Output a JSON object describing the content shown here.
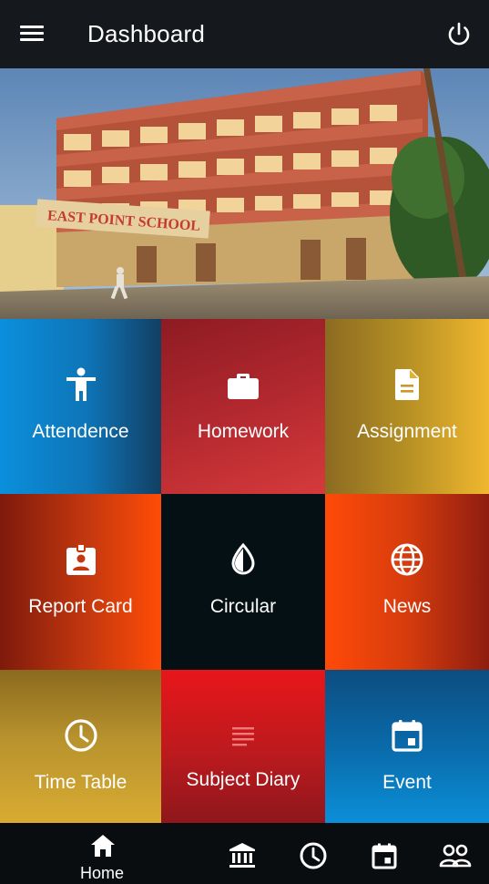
{
  "header": {
    "title": "Dashboard",
    "menu_icon": "menu-icon",
    "power_icon": "power-icon"
  },
  "banner": {
    "sign_text": "EAST POINT SCHOOL"
  },
  "tiles": [
    {
      "label": "Attendence",
      "icon": "person-icon",
      "color": "#0b8fdc"
    },
    {
      "label": "Homework",
      "icon": "briefcase-icon",
      "color": "#b2282f"
    },
    {
      "label": "Assignment",
      "icon": "document-icon",
      "color": "#f0b72f"
    },
    {
      "label": "Report Card",
      "icon": "badge-icon",
      "color": "#ff4c06"
    },
    {
      "label": "Circular",
      "icon": "drop-icon",
      "color": "#051014"
    },
    {
      "label": "News",
      "icon": "globe-icon",
      "color": "#ff4a08"
    },
    {
      "label": "Time Table",
      "icon": "clock-icon",
      "color": "#d8ab32"
    },
    {
      "label": "Subject Diary",
      "icon": "notes-icon",
      "color": "#e8161a"
    },
    {
      "label": "Event",
      "icon": "calendar-icon",
      "color": "#0b8fd8"
    }
  ],
  "bottom_nav": {
    "home_label": "Home",
    "icons": [
      "home-icon",
      "bank-icon",
      "clock-icon",
      "calendar-icon",
      "people-icon"
    ]
  }
}
